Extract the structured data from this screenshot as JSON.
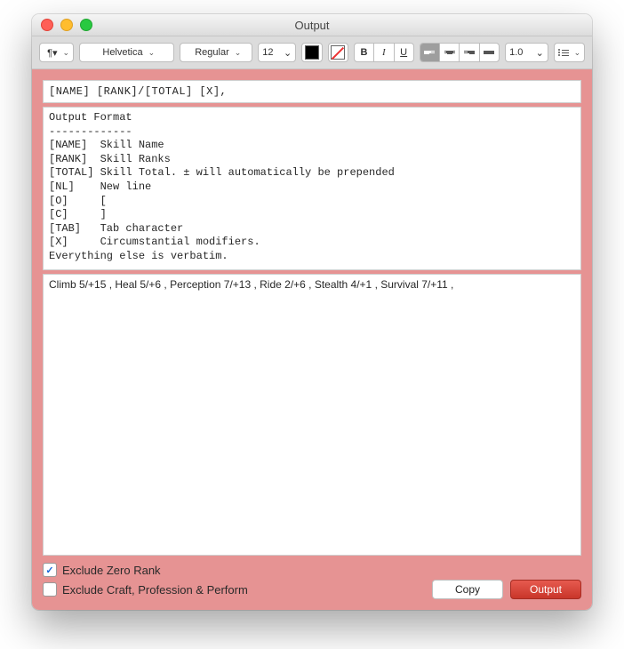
{
  "window": {
    "title": "Output"
  },
  "toolbar": {
    "paragraph": "¶▾",
    "font_family": "Helvetica",
    "font_style": "Regular",
    "font_size": "12",
    "bold": "B",
    "italic": "I",
    "underline": "U",
    "line_spacing": "1.0"
  },
  "fields": {
    "format_string": "[NAME] [RANK]/[TOTAL] [X],",
    "legend_text": "Output Format\n-------------\n[NAME]  Skill Name\n[RANK]  Skill Ranks\n[TOTAL] Skill Total. ± will automatically be prepended\n[NL]    New line\n[O]     [\n[C]     ]\n[TAB]   Tab character\n[X]     Circumstantial modifiers.\nEverything else is verbatim.",
    "output_text": "Climb 5/+15 , Heal 5/+6 , Perception 7/+13 , Ride 2/+6 , Stealth 4/+1 , Survival 7/+11 , "
  },
  "footer": {
    "exclude_zero_label": "Exclude Zero Rank",
    "exclude_zero_checked": true,
    "exclude_craft_label": "Exclude Craft, Profession & Perform",
    "exclude_craft_checked": false,
    "copy_label": "Copy",
    "output_label": "Output"
  },
  "colors": {
    "panel_bg": "#e69393",
    "primary_button": "#d9463a"
  }
}
